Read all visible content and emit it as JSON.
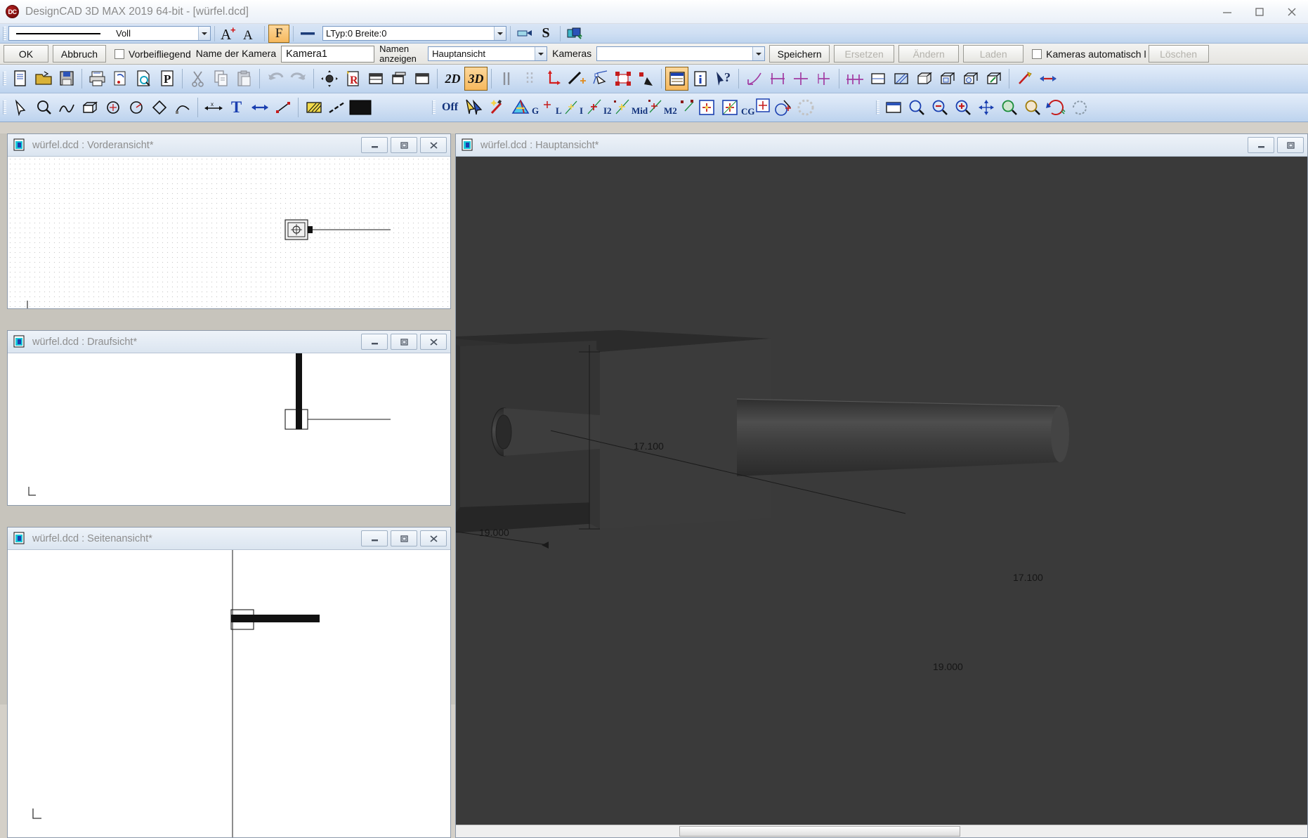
{
  "window": {
    "app_title": "DesignCAD 3D MAX 2019 64-bit - [würfel.dcd]",
    "logo_text": "DC",
    "minimize": "minimize",
    "maximize": "maximize",
    "close": "close"
  },
  "style_bar": {
    "linestyle_value": "Voll",
    "text_grow_icon": "text-grow-icon",
    "text_shrink_icon": "text-shrink-icon",
    "font_icon": "F",
    "linewidth_icon": "line-width-icon",
    "linetype_info": "LTyp:0  Breite:0",
    "layer_icon": "layer-icon",
    "snap_icon": "S",
    "color_icon": "color-icon"
  },
  "camera_bar": {
    "ok": "OK",
    "cancel": "Abbruch",
    "flyby_label": "Vorbeifliegend",
    "camera_name_label": "Name der Kamera",
    "camera_name_value": "Kamera1",
    "show_names_label": "Namen anzeigen",
    "view_select_value": "Hauptansicht",
    "cameras_label": "Kameras",
    "cameras_select_value": "",
    "save": "Speichern",
    "replace": "Ersetzen",
    "modify": "Ändern",
    "load": "Laden",
    "auto_cameras_label": "Kameras automatisch l",
    "delete": "Löschen"
  },
  "toolbar_main": {
    "icons": [
      {
        "name": "new-file-icon",
        "group": 1
      },
      {
        "name": "open-folder-icon",
        "group": 1
      },
      {
        "name": "save-disk-icon",
        "group": 1
      },
      {
        "name": "print-icon",
        "group": 2
      },
      {
        "name": "print-setup-icon",
        "group": 2
      },
      {
        "name": "print-preview-icon",
        "group": 2
      },
      {
        "name": "publish-pdf-icon",
        "group": 2
      },
      {
        "name": "cut-scissors-icon",
        "group": 3
      },
      {
        "name": "copy-icon",
        "group": 3
      },
      {
        "name": "paste-icon",
        "group": 3
      },
      {
        "name": "undo-icon",
        "group": 4
      },
      {
        "name": "redo-icon",
        "group": 4
      },
      {
        "name": "camera-move-icon",
        "group": 5
      },
      {
        "name": "render-icon",
        "group": 5
      },
      {
        "name": "view-tile-icon",
        "group": 5
      },
      {
        "name": "view-cascade-icon",
        "group": 5
      },
      {
        "name": "view-single-icon",
        "group": 5
      }
    ],
    "mode_2d": "2D",
    "mode_3d": "3D",
    "mode_active": "3D",
    "icons_right": [
      {
        "name": "grid-lines-icon"
      },
      {
        "name": "grid-dots-icon"
      },
      {
        "name": "axis-icon"
      },
      {
        "name": "line-point-icon"
      },
      {
        "name": "select-vertex-icon"
      },
      {
        "name": "select-box-icon"
      },
      {
        "name": "select-point-icon"
      },
      {
        "name": "properties-panel-icon"
      },
      {
        "name": "info-icon"
      },
      {
        "name": "help-pointer-icon"
      }
    ],
    "icons_far_right": [
      {
        "name": "dimension-angle-icon"
      },
      {
        "name": "dimension-horizontal-icon"
      },
      {
        "name": "dimension-cross-icon"
      },
      {
        "name": "dimension-vertical-icon"
      },
      {
        "name": "dimension-radius-icon"
      },
      {
        "name": "dimension-double-icon"
      },
      {
        "name": "hatch-area-icon"
      },
      {
        "name": "solid-box-icon"
      },
      {
        "name": "solid-cylinder-icon"
      },
      {
        "name": "solid-sphere-icon"
      },
      {
        "name": "extrude-icon"
      },
      {
        "name": "material-icon"
      },
      {
        "name": "arrow-tool-icon"
      },
      {
        "name": "arrow-double-icon"
      }
    ]
  },
  "toolbar_draw": {
    "icons": [
      {
        "name": "pointer-select-icon"
      },
      {
        "name": "zoom-window-icon"
      },
      {
        "name": "polyline-icon"
      },
      {
        "name": "box-icon"
      },
      {
        "name": "circle-center-icon"
      },
      {
        "name": "circle-radius-icon"
      },
      {
        "name": "polygon-icon"
      },
      {
        "name": "bezier-icon"
      },
      {
        "name": "dimension-linear-icon"
      },
      {
        "name": "text-tool-icon"
      },
      {
        "name": "arrow-tool-icon"
      },
      {
        "name": "node-edit-icon"
      },
      {
        "name": "hatch-icon"
      },
      {
        "name": "linetype-icon"
      },
      {
        "name": "color-swatch-icon"
      }
    ]
  },
  "toolbar_snap": {
    "off_label": "Off",
    "icons": [
      {
        "name": "snap-pointer-icon",
        "label": ""
      },
      {
        "name": "snap-magic-wand-icon",
        "label": ""
      },
      {
        "name": "snap-triangle-icon",
        "label": ""
      },
      {
        "name": "snap-grid-icon",
        "label": "G"
      },
      {
        "name": "snap-line-icon",
        "label": "L"
      },
      {
        "name": "snap-intersect-icon",
        "label": "I"
      },
      {
        "name": "snap-intersect2-icon",
        "label": "I2"
      },
      {
        "name": "snap-midpoint-icon",
        "label": "Mid"
      },
      {
        "name": "snap-midpoint2-icon",
        "label": "M2"
      },
      {
        "name": "snap-point-box-icon",
        "label": ""
      },
      {
        "name": "snap-point-box2-icon",
        "label": ""
      },
      {
        "name": "snap-centroid-icon",
        "label": "CG"
      },
      {
        "name": "snap-circle-icon",
        "label": ""
      },
      {
        "name": "snap-disabled-icon",
        "label": ""
      }
    ]
  },
  "toolbar_view": {
    "icons": [
      {
        "name": "view-window-icon"
      },
      {
        "name": "zoom-icon"
      },
      {
        "name": "zoom-out-icon"
      },
      {
        "name": "zoom-in-icon"
      },
      {
        "name": "pan-icon"
      },
      {
        "name": "zoom-extents-icon"
      },
      {
        "name": "zoom-previous-icon"
      },
      {
        "name": "rotate-view-icon"
      },
      {
        "name": "redraw-icon"
      }
    ]
  },
  "mdi_windows": [
    {
      "id": "front",
      "title": "würfel.dcd : Vorderansicht*",
      "minimize": "minimize",
      "maximize": "maximize",
      "close": "close",
      "axis_label": "L"
    },
    {
      "id": "top",
      "title": "würfel.dcd : Draufsicht*",
      "minimize": "minimize",
      "maximize": "maximize",
      "close": "close",
      "axis_label": "L"
    },
    {
      "id": "side",
      "title": "würfel.dcd : Seitenansicht*",
      "minimize": "minimize",
      "maximize": "maximize",
      "close": "close",
      "axis_label": "L"
    }
  ],
  "main_window": {
    "title": "würfel.dcd : Hauptansicht*",
    "minimize": "minimize",
    "maximize": "maximize",
    "dimensions": {
      "vertical": "17.100",
      "horizontal": "19.000"
    }
  },
  "colors": {
    "accent": "#f6b95e",
    "titlebar": "#eaf0f8",
    "toolbar": "#cfdff3",
    "viewport_bg": "#3a3a3a",
    "model_fill": "#3e3e3e",
    "model_top": "#2e2e2e"
  }
}
